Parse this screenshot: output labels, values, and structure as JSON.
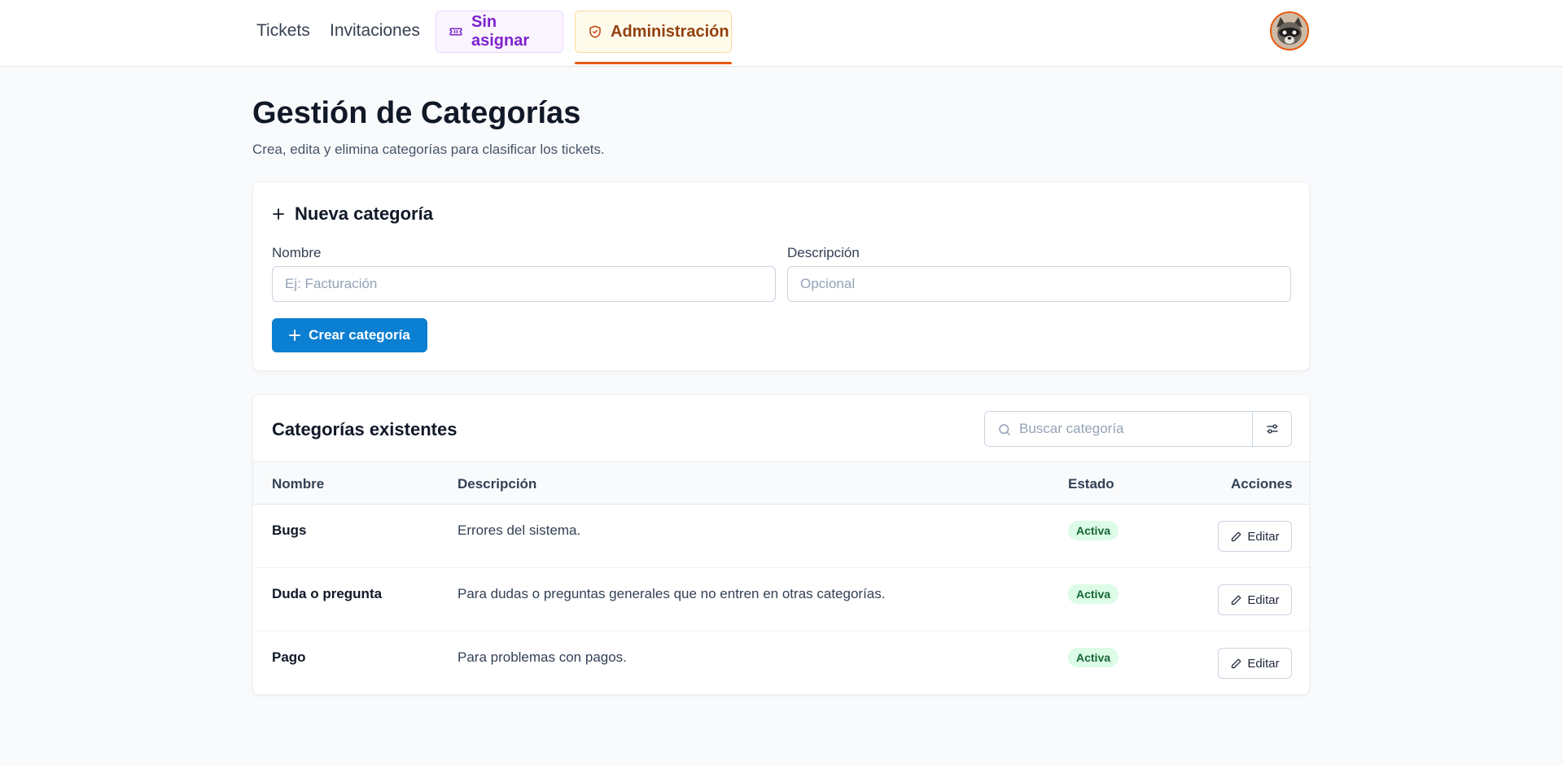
{
  "nav": {
    "tickets": "Tickets",
    "invitations": "Invitaciones",
    "unassigned": "Sin asignar",
    "admin": "Administración"
  },
  "page": {
    "title": "Gestión de Categorías",
    "subtitle": "Crea, edita y elimina categorías para clasificar los tickets."
  },
  "new_category": {
    "title": "Nueva categoría",
    "name_label": "Nombre",
    "name_placeholder": "Ej: Facturación",
    "desc_label": "Descripción",
    "desc_placeholder": "Opcional",
    "create_button": "Crear categoría"
  },
  "list": {
    "title": "Categorías existentes",
    "search_placeholder": "Buscar categoría",
    "columns": {
      "name": "Nombre",
      "description": "Descripción",
      "status": "Estado",
      "actions": "Acciones"
    },
    "rows": [
      {
        "name": "Bugs",
        "description": "Errores del sistema.",
        "status": "Activa",
        "action": "Editar"
      },
      {
        "name": "Duda o pregunta",
        "description": "Para dudas o preguntas generales que no entren en otras categorías.",
        "status": "Activa",
        "action": "Editar"
      },
      {
        "name": "Pago",
        "description": "Para problemas con pagos.",
        "status": "Activa",
        "action": "Editar"
      }
    ]
  },
  "icons": {
    "unassigned": "ticket-icon",
    "admin": "shield-check-icon",
    "new": "plus-icon",
    "create": "plus-icon",
    "search": "search-icon",
    "filter": "sliders-icon",
    "edit": "pencil-icon",
    "avatar": "raccoon-avatar"
  },
  "colors": {
    "primary": "#0b7fd1",
    "admin_accent": "#ea580c",
    "unassigned_accent": "#7e22ce",
    "status_active_bg": "#dcfce7",
    "status_active_text": "#166534"
  }
}
